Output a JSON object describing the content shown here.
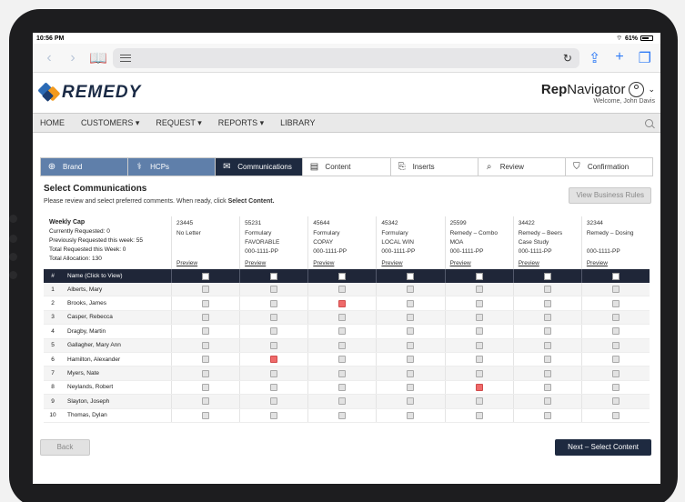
{
  "status": {
    "time": "10:56 PM",
    "battery": "61%"
  },
  "app": {
    "logo_text": "REMEDY",
    "brand_bold": "Rep",
    "brand_rest": "Navigator",
    "welcome": "Welcome, John Davis"
  },
  "nav": [
    "HOME",
    "CUSTOMERS ▾",
    "REQUEST ▾",
    "REPORTS ▾",
    "LIBRARY"
  ],
  "steps": [
    {
      "label": "Brand",
      "icon": "plus-circle-icon",
      "state": "done"
    },
    {
      "label": "HCPs",
      "icon": "stethoscope-icon",
      "state": "done"
    },
    {
      "label": "Communications",
      "icon": "envelope-icon",
      "state": "active"
    },
    {
      "label": "Content",
      "icon": "document-icon",
      "state": "todo"
    },
    {
      "label": "Inserts",
      "icon": "insert-icon",
      "state": "todo"
    },
    {
      "label": "Review",
      "icon": "search-icon",
      "state": "todo"
    },
    {
      "label": "Confirmation",
      "icon": "shield-icon",
      "state": "todo"
    }
  ],
  "page": {
    "title": "Select Communications",
    "subtitle_pre": "Please review and select preferred comments. When ready, click ",
    "subtitle_bold": "Select Content.",
    "view_rules": "View Business Rules",
    "back": "Back",
    "next": "Next – Select Content"
  },
  "cap": {
    "title": "Weekly Cap",
    "lines": [
      "Currently Requested: 0",
      "Previously Requested this week: 55",
      "Total Requested this Week: 0",
      "Total Allocation: 130"
    ]
  },
  "columns": [
    {
      "code": "23445",
      "l1": "No Letter",
      "l2": "",
      "id": "",
      "preview": "Preview"
    },
    {
      "code": "55231",
      "l1": "Formulary",
      "l2": "FAVORABLE",
      "id": "000-1111-PP",
      "preview": "Preview"
    },
    {
      "code": "45644",
      "l1": "Formulary",
      "l2": "COPAY",
      "id": "000-1111-PP",
      "preview": "Preview"
    },
    {
      "code": "45342",
      "l1": "Formulary",
      "l2": "LOCAL WIN",
      "id": "000-1111-PP",
      "preview": "Preview"
    },
    {
      "code": "25599",
      "l1": "Remedy – Combo",
      "l2": "MOA",
      "id": "000-1111-PP",
      "preview": "Preview"
    },
    {
      "code": "34422",
      "l1": "Remedy – Beers",
      "l2": "Case Study",
      "id": "000-1111-PP",
      "preview": "Preview"
    },
    {
      "code": "32344",
      "l1": "Remedy – Dosing",
      "l2": "",
      "id": "000-1111-PP",
      "preview": "Preview"
    }
  ],
  "table_head": {
    "num": "#",
    "name": "Name (Click to View)"
  },
  "rows": [
    {
      "n": "1",
      "name": "Alberts, Mary",
      "checked": []
    },
    {
      "n": "2",
      "name": "Brooks, James",
      "checked": [
        2
      ]
    },
    {
      "n": "3",
      "name": "Casper, Rebecca",
      "checked": []
    },
    {
      "n": "4",
      "name": "Dragby, Martin",
      "checked": []
    },
    {
      "n": "5",
      "name": "Gallagher, Mary Ann",
      "checked": []
    },
    {
      "n": "6",
      "name": "Hamilton, Alexander",
      "checked": [
        1
      ]
    },
    {
      "n": "7",
      "name": "Myers, Nate",
      "checked": []
    },
    {
      "n": "8",
      "name": "Neylands, Robert",
      "checked": [
        4
      ]
    },
    {
      "n": "9",
      "name": "Slayton, Joseph",
      "checked": []
    },
    {
      "n": "10",
      "name": "Thomas, Dylan",
      "checked": []
    }
  ],
  "colors": {
    "accent_dark": "#1e2a40",
    "step_done": "#5f7faa",
    "checked": "#ef6a6a"
  }
}
